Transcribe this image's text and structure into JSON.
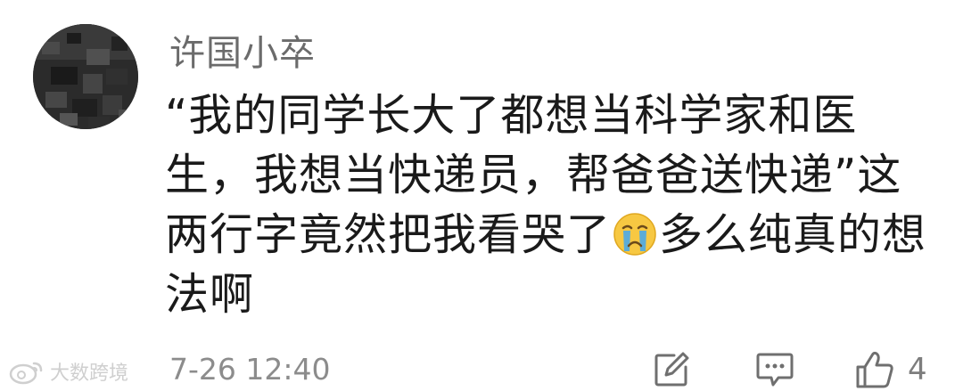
{
  "comment": {
    "username": "许国小卒",
    "body_part1": "“我的同学长大了都想当科学家和医生，我想当快递员，帮爸爸送快递”这两行字竟然把我看哭了",
    "emoji_icon": "crying-face-icon",
    "body_part2": "多么纯真的想法啊",
    "timestamp": "7-26 12:40",
    "like_count": "4"
  },
  "watermark": {
    "text": "大数跨境",
    "icon": "weibo-logo-icon"
  },
  "actions": {
    "edit_icon": "edit-icon",
    "reply_icon": "comment-icon",
    "like_icon": "thumbs-up-icon"
  },
  "colors": {
    "username": "#6b6b6b",
    "body_text": "#1a1a1a",
    "meta_text": "#8c8c8c",
    "icon_stroke": "#6f6f6f"
  }
}
